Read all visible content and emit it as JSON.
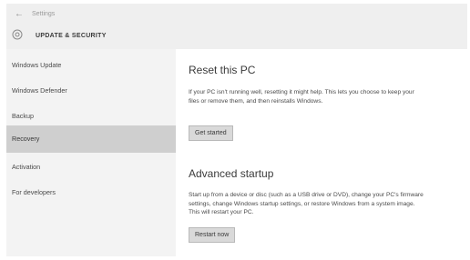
{
  "window": {
    "app_title": "Settings",
    "back_glyph": "←",
    "header_icon": "gear-icon",
    "header_title": "UPDATE & SECURITY"
  },
  "sidebar": {
    "items": [
      {
        "label": "Windows Update",
        "selected": false
      },
      {
        "label": "Windows Defender",
        "selected": false
      },
      {
        "label": "Backup",
        "selected": false
      },
      {
        "label": "Recovery",
        "selected": true
      },
      {
        "label": "Activation",
        "selected": false
      },
      {
        "label": "For developers",
        "selected": false
      }
    ]
  },
  "main": {
    "reset": {
      "title": "Reset this PC",
      "description": "If your PC isn't running well, resetting it might help. This lets you choose to keep your files or remove them, and then reinstalls Windows.",
      "button_label": "Get started"
    },
    "advanced": {
      "title": "Advanced startup",
      "description": "Start up from a device or disc (such as a USB drive or DVD), change your PC's firmware settings, change Windows startup settings, or restore Windows from a system image. This will restart your PC.",
      "button_label": "Restart now"
    }
  },
  "colors": {
    "selected_background": "#cfcfcf",
    "sidebar_background": "#f3f3f3",
    "content_background": "#ffffff",
    "button_background": "#d9d9d9"
  }
}
